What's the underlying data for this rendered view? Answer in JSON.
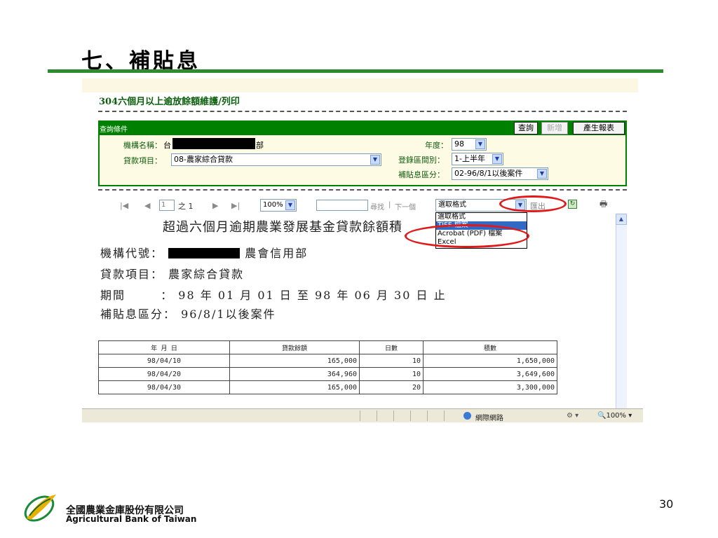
{
  "slide": {
    "title": "七、補貼息",
    "page_number": "30"
  },
  "screen": {
    "heading": "304六個月以上逾放餘額維護/列印",
    "query": {
      "bar_label": "查詢條件",
      "buttons": {
        "query": "查詢",
        "add": "新增",
        "report": "產生報表"
      },
      "org_name_label": "機構名稱：",
      "org_name_value_start": "台",
      "org_name_value_end": "部",
      "loan_item_label": "貸款項目：",
      "loan_item_value": "08-農家綜合貸款",
      "year_label": "年度：",
      "year_value": "98",
      "period_label": "登錄區間別：",
      "period_value": "1-上半年",
      "subsidy_label": "補貼息區分：",
      "subsidy_value": "02-96/8/1以後案件"
    },
    "toolbar": {
      "page_current": "1",
      "page_of": "之",
      "page_total": "1",
      "zoom": "100%",
      "find_label": "尋找",
      "sep": "|",
      "next_label": "下一個",
      "format_select": "選取格式",
      "export_label": "匯出"
    },
    "format_dropdown": [
      "選取格式",
      "TIFF 檔案",
      "Acrobat (PDF) 檔案",
      "Excel"
    ],
    "report": {
      "title": "超過六個月逾期農業發展基金貸款餘額積",
      "org_label": "機構代號：",
      "org_value_end": "農會信用部",
      "loan_label": "貸款項目：",
      "loan_value": "農家綜合貸款",
      "period_label": "期間",
      "period_value": "： 98 年 01 月 01 日 至 98 年 06 月 30 日 止",
      "subsidy_label": "補貼息區分：",
      "subsidy_value": "96/8/1以後案件",
      "table": {
        "headers": [
          "年 月 日",
          "貸款餘額",
          "日數",
          "積數"
        ],
        "rows": [
          [
            "98/04/10",
            "165,000",
            "10",
            "1,650,000"
          ],
          [
            "98/04/20",
            "364,960",
            "10",
            "3,649,600"
          ],
          [
            "98/04/30",
            "165,000",
            "20",
            "3,300,000"
          ]
        ]
      }
    },
    "statusbar": {
      "zone": "網際網路",
      "zoom": "100%"
    }
  },
  "footer": {
    "company_cn": "全國農業金庫股份有限公司",
    "company_en": "Agricultural Bank of Taiwan"
  },
  "colors": {
    "green_bar": "#008000",
    "title_rule": "#2e8b2e",
    "highlight_oval": "#e01a1a",
    "dropdown_selection": "#316ac5"
  }
}
